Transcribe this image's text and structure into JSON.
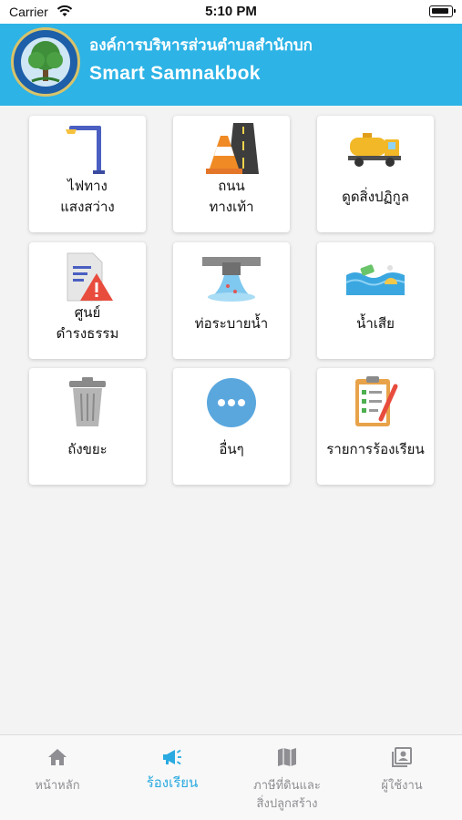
{
  "status_bar": {
    "carrier": "Carrier",
    "time": "5:10 PM"
  },
  "header": {
    "title": "องค์การบริหารส่วนตำบลสำนักบก",
    "subtitle": "Smart Samnakbok"
  },
  "menu": [
    {
      "label": "ไฟทาง\nแสงสว่าง",
      "icon": "street-light-icon"
    },
    {
      "label": "ถนน\nทางเท้า",
      "icon": "road-cone-icon"
    },
    {
      "label": "ดูดสิ่งปฏิกูล",
      "icon": "sewage-truck-icon"
    },
    {
      "label": "ศูนย์\nดำรงธรรม",
      "icon": "document-warning-icon"
    },
    {
      "label": "ท่อระบายน้ำ",
      "icon": "drain-pipe-icon"
    },
    {
      "label": "น้ำเสีย",
      "icon": "wastewater-icon"
    },
    {
      "label": "ถังขยะ",
      "icon": "trash-bin-icon"
    },
    {
      "label": "อื่นๆ",
      "icon": "more-icon"
    },
    {
      "label": "รายการร้องเรียน",
      "icon": "clipboard-list-icon"
    }
  ],
  "tabs": [
    {
      "label": "หน้าหลัก",
      "icon": "home-icon",
      "active": false
    },
    {
      "label": "ร้องเรียน",
      "icon": "megaphone-icon",
      "active": true
    },
    {
      "label": "ภาษีที่ดินและ\nสิ่งปลูกสร้าง",
      "icon": "map-icon",
      "active": false
    },
    {
      "label": "ผู้ใช้งาน",
      "icon": "user-profile-icon",
      "active": false
    }
  ],
  "colors": {
    "header": "#2db3e6",
    "active_tab": "#2aaae1",
    "inactive_tab": "#8e8e93"
  }
}
